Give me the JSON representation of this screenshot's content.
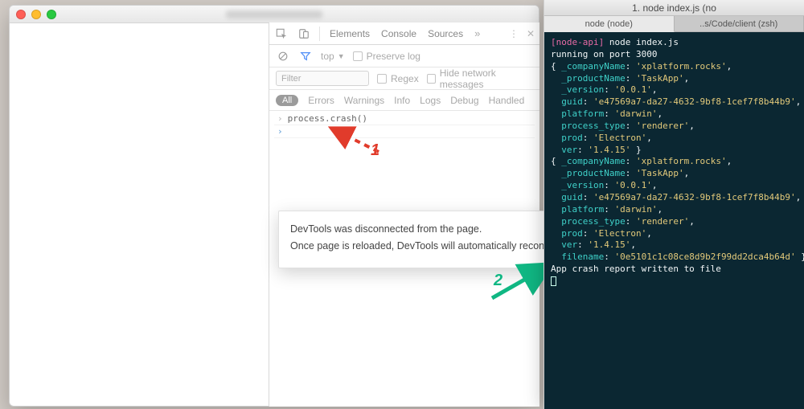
{
  "terminal": {
    "window_title": "1. node index.js (no",
    "tabs": [
      {
        "label": "node (node)",
        "active": true
      },
      {
        "label": "..s/Code/client (zsh)",
        "active": false
      }
    ],
    "prompt_context": "[node-api]",
    "command": "node index.js",
    "running_line": "running on port 3000",
    "obj1": {
      "_companyName": "xplatform.rocks",
      "_productName": "TaskApp",
      "_version": "0.0.1",
      "guid": "e47569a7-da27-4632-9bf8-1cef7f8b44b9",
      "platform": "darwin",
      "process_type": "renderer",
      "prod": "Electron",
      "ver": "1.4.15"
    },
    "obj2": {
      "_companyName": "xplatform.rocks",
      "_productName": "TaskApp",
      "_version": "0.0.1",
      "guid": "e47569a7-da27-4632-9bf8-1cef7f8b44b9",
      "platform": "darwin",
      "process_type": "renderer",
      "prod": "Electron",
      "ver": "1.4.15",
      "filename": "0e5101c1c08ce8d9b2f99dd2dca4b64d"
    },
    "crash_line": "App crash report written to file"
  },
  "devtools": {
    "tabs": {
      "elements": "Elements",
      "console": "Console",
      "sources": "Sources",
      "more": "»"
    },
    "toolbar": {
      "context": "top",
      "preserve": "Preserve log"
    },
    "filterbar": {
      "placeholder": "Filter",
      "regex": "Regex",
      "hide": "Hide network messages"
    },
    "chips": {
      "all": "All",
      "errors": "Errors",
      "warnings": "Warnings",
      "info": "Info",
      "logs": "Logs",
      "debug": "Debug",
      "handled": "Handled"
    },
    "console_line": "process.crash()"
  },
  "disconnect": {
    "line1": "DevTools was disconnected from the page.",
    "line2": "Once page is reloaded, DevTools will automatically reconnect."
  },
  "annotations": {
    "n1": "1",
    "n2": "2"
  }
}
